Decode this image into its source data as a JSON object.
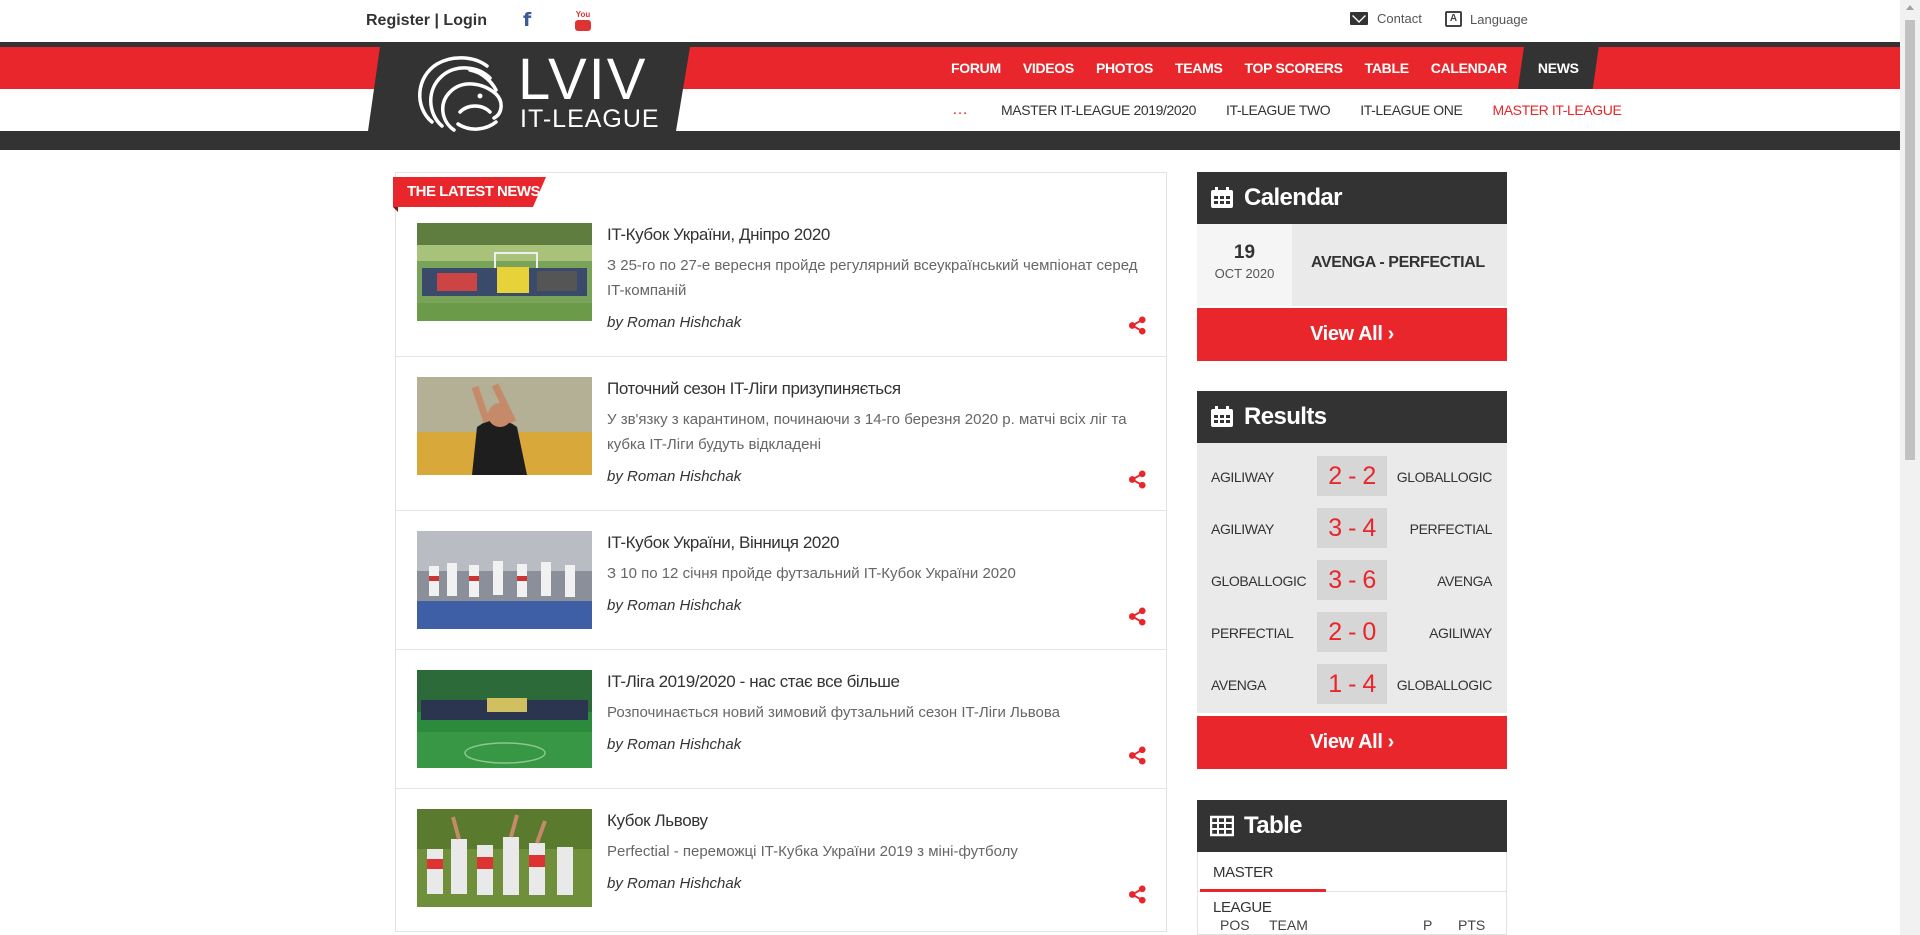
{
  "topbar": {
    "register": "Register",
    "separator": "|",
    "login": "Login",
    "facebook_icon": "f",
    "youtube_label": "You",
    "contact": "Contact",
    "language": "Language"
  },
  "logo": {
    "title": "LVIV",
    "subtitle": "IT-LEAGUE"
  },
  "main_nav": [
    "FORUM",
    "VIDEOS",
    "PHOTOS",
    "TEAMS",
    "TOP SCORERS",
    "TABLE",
    "CALENDAR",
    "NEWS"
  ],
  "main_nav_active": "NEWS",
  "sub_nav": [
    {
      "label": "…",
      "style": "dots"
    },
    {
      "label": "MASTER IT-LEAGUE 2019/2020",
      "style": "normal"
    },
    {
      "label": "IT-LEAGUE TWO",
      "style": "normal"
    },
    {
      "label": "IT-LEAGUE ONE",
      "style": "normal"
    },
    {
      "label": "MASTER IT-LEAGUE",
      "style": "red"
    }
  ],
  "news": {
    "section_title": "THE LATEST NEWS",
    "by_prefix": "by",
    "items": [
      {
        "title": "IT-Кубок України, Дніпро 2020",
        "desc": "З 25-го по 27-е вересня пройде регулярний всеукраїнський чемпіонат серед IT-компаній",
        "author": "Roman Hishchak"
      },
      {
        "title": "Поточний сезон IT-Ліги призупиняється",
        "desc": "У зв'язку з карантином, починаючи з 14-го березня 2020 р. матчі всіх ліг та кубка IT-Ліги будуть відкладені",
        "author": "Roman Hishchak"
      },
      {
        "title": "IT-Кубок України, Вінниця 2020",
        "desc": "З 10 по 12 січня пройде футзальний IT-Кубок України 2020",
        "author": "Roman Hishchak"
      },
      {
        "title": "IT-Ліга 2019/2020 - нас стає все більше",
        "desc": "Розпочинається новий зимовий футзальний сезон IT-Ліги Львова",
        "author": "Roman Hishchak"
      },
      {
        "title": "Кубок Львову",
        "desc": "Perfectial - переможці IT-Кубка України 2019 з міні-футболу",
        "author": "Roman Hishchak"
      }
    ]
  },
  "calendar": {
    "title": "Calendar",
    "day": "19",
    "month": "OCT 2020",
    "match": "AVENGA - PERFECTIAL",
    "view_all": "View All ›"
  },
  "results": {
    "title": "Results",
    "rows": [
      {
        "home": "AGILIWAY",
        "score": "2 - 2",
        "away": "GLOBALLOGIC"
      },
      {
        "home": "AGILIWAY",
        "score": "3 - 4",
        "away": "PERFECTIAL"
      },
      {
        "home": "GLOBALLOGIC",
        "score": "3 - 6",
        "away": "AVENGA"
      },
      {
        "home": "PERFECTIAL",
        "score": "2 - 0",
        "away": "AGILIWAY"
      },
      {
        "home": "AVENGA",
        "score": "1 - 4",
        "away": "GLOBALLOGIC"
      }
    ],
    "view_all": "View All ›"
  },
  "table": {
    "title": "Table",
    "tab": "MASTER LEAGUE",
    "headers": [
      "POS",
      "TEAM",
      "P",
      "PTS"
    ]
  },
  "colors": {
    "accent": "#e8262b",
    "dark": "#333333"
  }
}
